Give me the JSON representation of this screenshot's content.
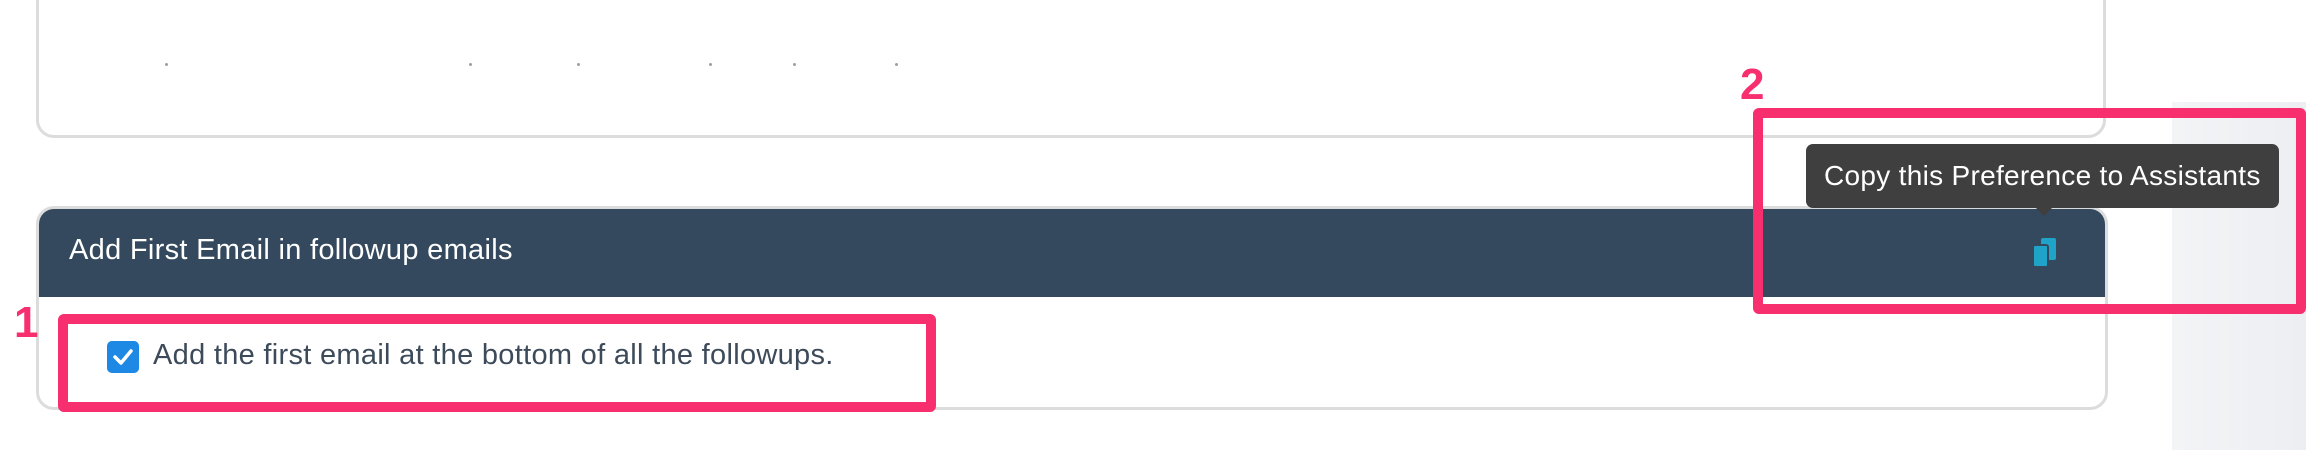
{
  "card": {
    "title": "Add First Email in followup emails",
    "copy_icon": "copy-icon",
    "checkbox": {
      "checked": true,
      "label": "Add the first email at the bottom of all the followups."
    }
  },
  "tooltip": {
    "text": "Copy this Preference to Assistants"
  },
  "annotations": {
    "label_1": "1",
    "label_2": "2",
    "color": "#f72f6f"
  },
  "colors": {
    "header_bg": "#34495e",
    "checkbox": "#1e88e5",
    "copy_icon": "#1fa3c9",
    "tooltip_bg": "#3f3f3f"
  }
}
